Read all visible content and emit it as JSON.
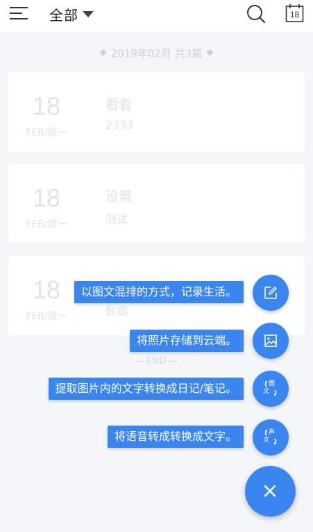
{
  "header": {
    "filter_label": "全部",
    "calendar_day": "18",
    "icons": [
      "menu-icon",
      "search-icon",
      "calendar-icon"
    ]
  },
  "month_header": "2019年02月 共3篇",
  "cards": [
    {
      "day": "18",
      "sub": "FEB/周一",
      "title": "看看",
      "body": "2333"
    },
    {
      "day": "18",
      "sub": "FEB/周一",
      "title": "设置",
      "body": "测试"
    },
    {
      "day": "18",
      "sub": "FEB/周一",
      "title": "",
      "body": "数据"
    }
  ],
  "end_label": "— END —",
  "fab_menu": {
    "items": [
      {
        "label": "以图文混排的方式，记录生活。",
        "icon": "edit-icon"
      },
      {
        "label": "将照片存储到云端。",
        "icon": "image-icon"
      },
      {
        "label": "提取图片内的文字转换成日记/笔记。",
        "icon": "image-to-text-icon",
        "glyph": [
          "图",
          "文"
        ]
      },
      {
        "label": "将语音转成转换成文字。",
        "icon": "voice-to-text-icon",
        "glyph": [
          "声",
          "文"
        ]
      }
    ],
    "close_icon": "close-icon"
  },
  "colors": {
    "accent": "#3a86f1",
    "background": "#f5f6f8",
    "faded_text": "#e1e3e6"
  }
}
